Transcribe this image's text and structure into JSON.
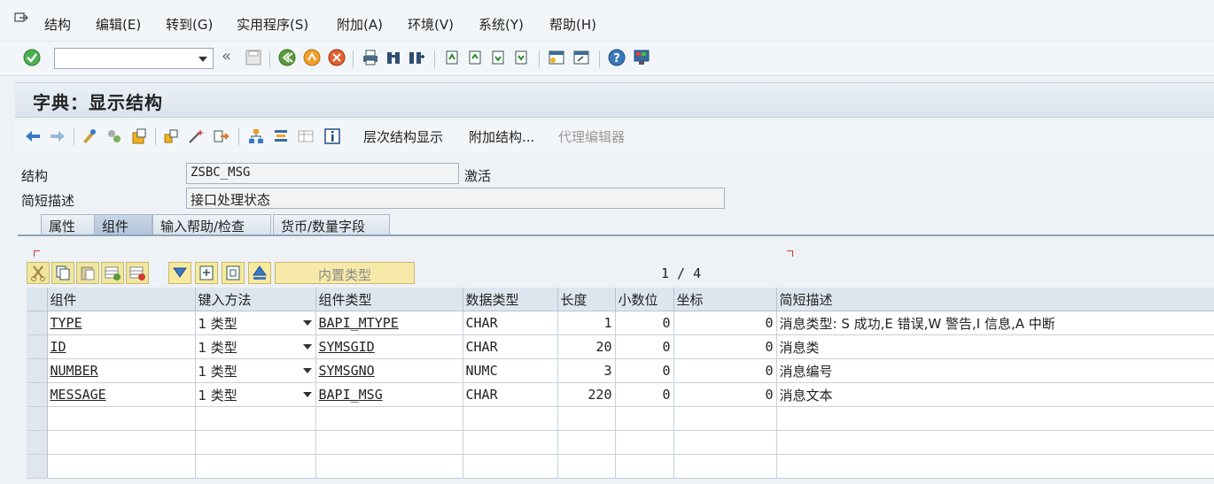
{
  "menubar": {
    "items": [
      "结构",
      "编辑(E)",
      "转到(G)",
      "实用程序(S)",
      "附加(A)",
      "环境(V)",
      "系统(Y)",
      "帮助(H)"
    ]
  },
  "toolbar": {
    "command_value": "",
    "icons": [
      "enter-icon",
      "back-double-icon",
      "save-icon",
      "back-icon",
      "exit-icon",
      "cancel-icon",
      "print-icon",
      "find-icon",
      "find-next-icon",
      "first-page-icon",
      "prev-page-icon",
      "next-page-icon",
      "last-page-icon",
      "new-session-icon",
      "shortcut-icon",
      "help-icon",
      "customize-icon"
    ]
  },
  "title": "字典：显示结构",
  "app_toolbar": {
    "buttons": [
      "层次结构显示",
      "附加结构...",
      "代理编辑器"
    ]
  },
  "fields": {
    "structure_label": "结构",
    "structure_value": "ZSBC_MSG",
    "structure_status": "激活",
    "desc_label": "简短描述",
    "desc_value": "接口处理状态"
  },
  "tabs": [
    "属性",
    "组件",
    "输入帮助/检查",
    "货币/数量字段"
  ],
  "active_tab": "组件",
  "grid": {
    "builtin_label": "内置类型",
    "pager": "1 / 4",
    "columns": [
      "组件",
      "键入方法",
      "组件类型",
      "数据类型",
      "长度",
      "小数位",
      "坐标",
      "简短描述"
    ],
    "rows": [
      {
        "component": "TYPE",
        "method": "1 类型",
        "ctype": "BAPI_MTYPE",
        "dtype": "CHAR",
        "length": "1",
        "decimals": "0",
        "coord": "0",
        "desc": "消息类型: S 成功,E 错误,W 警告,I 信息,A 中断"
      },
      {
        "component": "ID",
        "method": "1 类型",
        "ctype": "SYMSGID",
        "dtype": "CHAR",
        "length": "20",
        "decimals": "0",
        "coord": "0",
        "desc": "消息类"
      },
      {
        "component": "NUMBER",
        "method": "1 类型",
        "ctype": "SYMSGNO",
        "dtype": "NUMC",
        "length": "3",
        "decimals": "0",
        "coord": "0",
        "desc": "消息编号"
      },
      {
        "component": "MESSAGE",
        "method": "1 类型",
        "ctype": "BAPI_MSG",
        "dtype": "CHAR",
        "length": "220",
        "decimals": "0",
        "coord": "0",
        "desc": "消息文本"
      }
    ]
  },
  "colors": {
    "accent": "#8fa4ba",
    "grid_header": "#dde6ef",
    "button_yellow": "#f7eaa8"
  }
}
